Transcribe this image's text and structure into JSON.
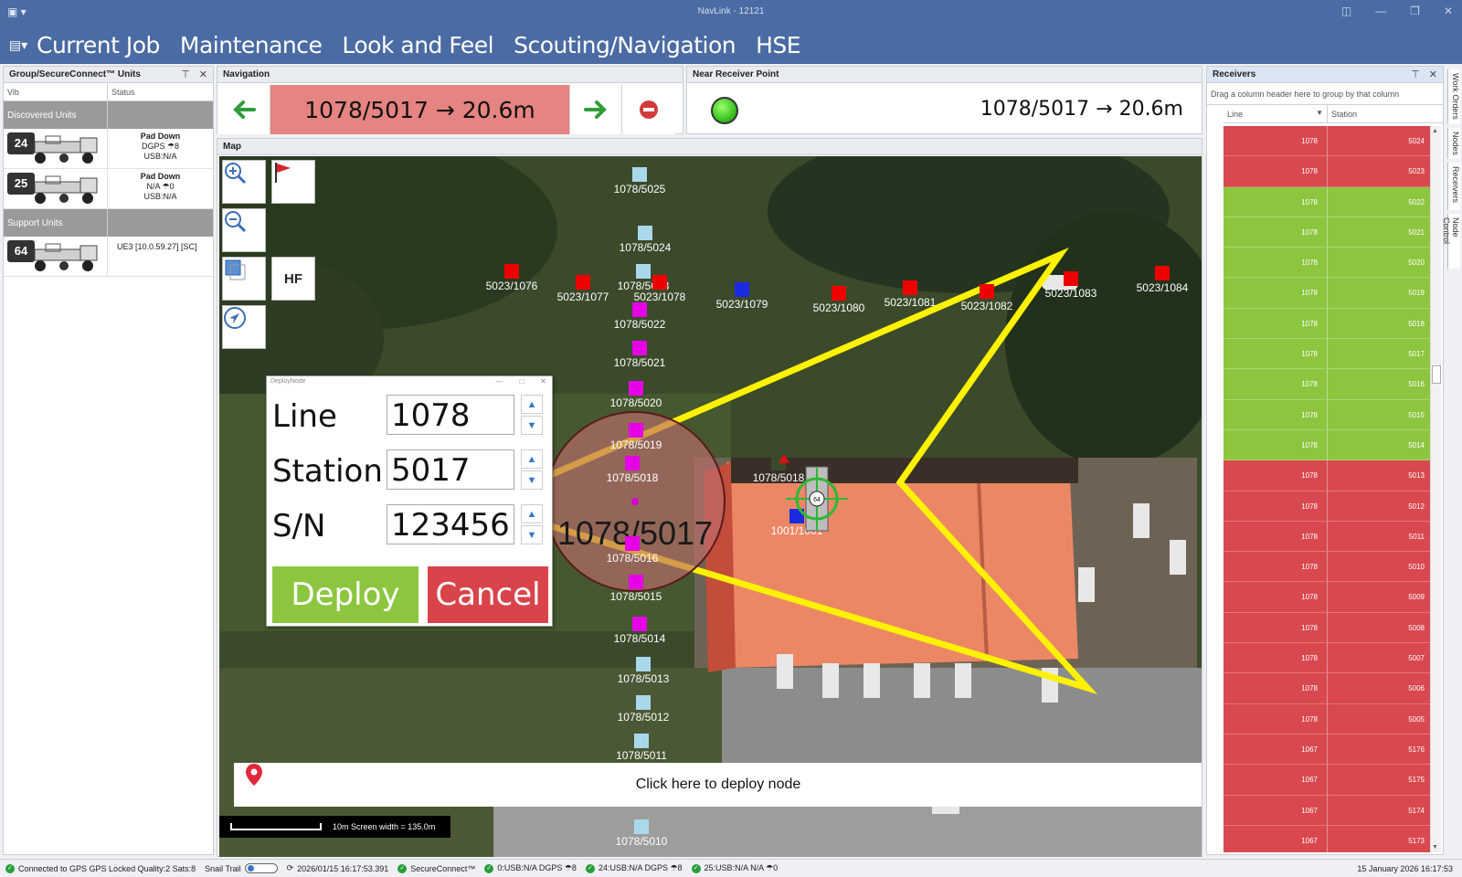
{
  "window": {
    "title": "NavLink - 12121"
  },
  "menu": [
    "Current Job",
    "Maintenance",
    "Look and Feel",
    "Scouting/Navigation",
    "HSE"
  ],
  "units_panel": {
    "title": "Group/SecureConnect™ Units",
    "col_vib": "Vib",
    "col_status": "Status",
    "discovered_label": "Discovered Units",
    "support_label": "Support Units",
    "discovered": [
      {
        "id": "24",
        "status1": "Pad Down",
        "status2": "DGPS ☂8",
        "status3": "USB:N/A"
      },
      {
        "id": "25",
        "status1": "Pad Down",
        "status2": "N/A ☂0",
        "status3": "USB:N/A"
      }
    ],
    "support": [
      {
        "id": "64",
        "status": "UE3    [10.0.59.27]  [SC]"
      }
    ]
  },
  "navigation": {
    "title": "Navigation",
    "display": "1078/5017 → 20.6m"
  },
  "near_receiver": {
    "title": "Near Receiver Point",
    "display": "1078/5017 → 20.6m"
  },
  "map": {
    "title": "Map",
    "hf_label": "HF",
    "deploy_bar_text": "Click here to deploy node",
    "scale_text": "10m Screen width = 135.0m",
    "receiver_labels": [
      {
        "text": "1078/5025"
      },
      {
        "text": "1078/5024"
      },
      {
        "text": "1078/5023"
      },
      {
        "text": "1078/5022"
      },
      {
        "text": "1078/5021"
      },
      {
        "text": "1078/5020"
      },
      {
        "text": "1078/5019"
      },
      {
        "text": "1078/5018"
      },
      {
        "text": "1078/5016"
      },
      {
        "text": "1078/5015"
      },
      {
        "text": "1078/5014"
      },
      {
        "text": "1078/5013"
      },
      {
        "text": "1078/5012"
      },
      {
        "text": "1078/5011"
      },
      {
        "text": "1078/5010"
      },
      {
        "text": "5023/1076"
      },
      {
        "text": "5023/1077"
      },
      {
        "text": "5023/1078"
      },
      {
        "text": "5023/1079"
      },
      {
        "text": "5023/1080"
      },
      {
        "text": "5023/1081"
      },
      {
        "text": "5023/1082"
      },
      {
        "text": "5023/1083"
      },
      {
        "text": "5023/1084"
      },
      {
        "text": "1001/1001"
      },
      {
        "text": "1078/5018"
      }
    ],
    "target_label": "1078/5017",
    "vehicle_id": "64"
  },
  "deploy_dialog": {
    "title": "DeployNode",
    "line_label": "Line",
    "line_value": "1078",
    "station_label": "Station",
    "station_value": "5017",
    "sn_label": "S/N",
    "sn_value": "123456",
    "deploy_label": "Deploy",
    "cancel_label": "Cancel",
    "deploy_color": "#8cc63f",
    "cancel_color": "#d9444b"
  },
  "receivers": {
    "title": "Receivers",
    "hint": "Drag a column header here to group by that column",
    "col_line": "Line",
    "col_station": "Station",
    "colors": {
      "red": "#d9484e",
      "green": "#8cc63f"
    },
    "rows": [
      {
        "line": "1078",
        "station": "5024",
        "color": "red"
      },
      {
        "line": "1078",
        "station": "5023",
        "color": "red"
      },
      {
        "line": "1078",
        "station": "5022",
        "color": "green"
      },
      {
        "line": "1078",
        "station": "5021",
        "color": "green"
      },
      {
        "line": "1078",
        "station": "5020",
        "color": "green"
      },
      {
        "line": "1078",
        "station": "5019",
        "color": "green"
      },
      {
        "line": "1078",
        "station": "5018",
        "color": "green"
      },
      {
        "line": "1078",
        "station": "5017",
        "color": "green"
      },
      {
        "line": "1078",
        "station": "5016",
        "color": "green"
      },
      {
        "line": "1078",
        "station": "5015",
        "color": "green"
      },
      {
        "line": "1078",
        "station": "5014",
        "color": "green"
      },
      {
        "line": "1078",
        "station": "5013",
        "color": "red"
      },
      {
        "line": "1078",
        "station": "5012",
        "color": "red"
      },
      {
        "line": "1078",
        "station": "5011",
        "color": "red"
      },
      {
        "line": "1078",
        "station": "5010",
        "color": "red"
      },
      {
        "line": "1078",
        "station": "5009",
        "color": "red"
      },
      {
        "line": "1078",
        "station": "5008",
        "color": "red"
      },
      {
        "line": "1078",
        "station": "5007",
        "color": "red"
      },
      {
        "line": "1078",
        "station": "5006",
        "color": "red"
      },
      {
        "line": "1078",
        "station": "5005",
        "color": "red"
      },
      {
        "line": "1067",
        "station": "5176",
        "color": "red"
      },
      {
        "line": "1067",
        "station": "5175",
        "color": "red"
      },
      {
        "line": "1067",
        "station": "5174",
        "color": "red"
      },
      {
        "line": "1067",
        "station": "5173",
        "color": "red"
      }
    ]
  },
  "side_tabs": [
    "Work Orders",
    "Nodes",
    "Receivers",
    "Node Control"
  ],
  "status_bar": {
    "gps": "Connected to GPS GPS Locked Quality:2 Sats:8",
    "snail_trail": "Snail Trail",
    "gps_time": "2026/01/15 16:17:53.391",
    "secureconnect": "SecureConnect™",
    "unit0": "0:USB:N/A DGPS ☂8",
    "unit24": "24:USB:N/A DGPS ☂8",
    "unit25": "25:USB:N/A N/A ☂0",
    "datetime": "15 January 2026 16:17:53"
  }
}
